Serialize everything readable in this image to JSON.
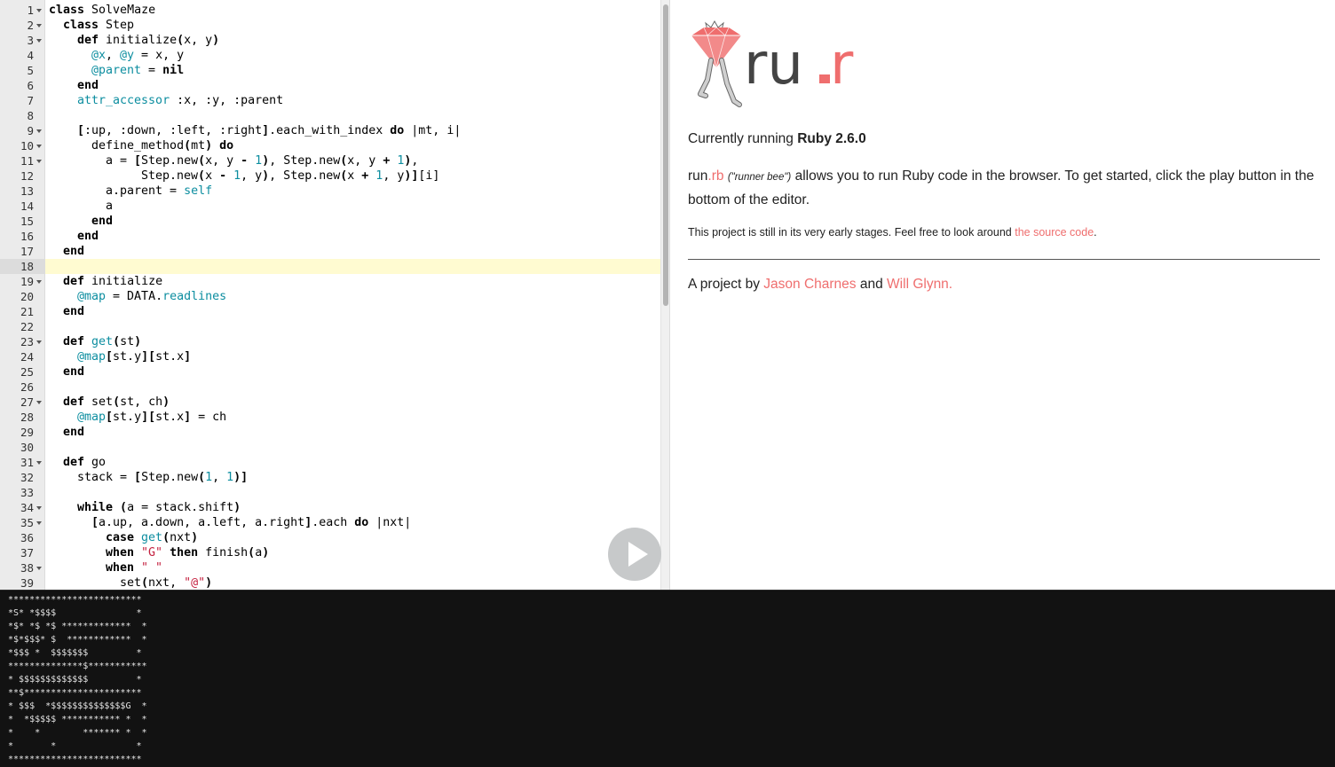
{
  "editor": {
    "active_line": 18,
    "run_button_label": "Run",
    "lines": [
      {
        "n": "1",
        "f": true,
        "i": 0,
        "t": [
          [
            "k",
            "class"
          ],
          [
            "p",
            " SolveMaze"
          ]
        ]
      },
      {
        "n": "2",
        "f": true,
        "i": 1,
        "t": [
          [
            "k",
            "class"
          ],
          [
            "p",
            " Step"
          ]
        ]
      },
      {
        "n": "3",
        "f": true,
        "i": 2,
        "t": [
          [
            "k",
            "def"
          ],
          [
            "p",
            " initialize"
          ],
          [
            "k",
            "("
          ],
          [
            "p",
            "x, y"
          ],
          [
            "k",
            ")"
          ]
        ]
      },
      {
        "n": "4",
        "f": false,
        "i": 3,
        "t": [
          [
            "i",
            "@x"
          ],
          [
            "p",
            ", "
          ],
          [
            "i",
            "@y"
          ],
          [
            "p",
            " = x, y"
          ]
        ]
      },
      {
        "n": "5",
        "f": false,
        "i": 3,
        "t": [
          [
            "i",
            "@parent"
          ],
          [
            "p",
            " = "
          ],
          [
            "k",
            "nil"
          ]
        ]
      },
      {
        "n": "6",
        "f": false,
        "i": 2,
        "t": [
          [
            "k",
            "end"
          ]
        ]
      },
      {
        "n": "7",
        "f": false,
        "i": 2,
        "t": [
          [
            "i",
            "attr_accessor"
          ],
          [
            "p",
            " :x, :y, :parent"
          ]
        ]
      },
      {
        "n": "8",
        "f": false,
        "i": 0,
        "t": []
      },
      {
        "n": "9",
        "f": true,
        "i": 2,
        "t": [
          [
            "k",
            "["
          ],
          [
            "p",
            ":up, :down, :left, :right"
          ],
          [
            "k",
            "]"
          ],
          [
            "p",
            ".each_with_index "
          ],
          [
            "k",
            "do"
          ],
          [
            "p",
            " |mt, i|"
          ]
        ]
      },
      {
        "n": "10",
        "f": true,
        "i": 3,
        "t": [
          [
            "p",
            "define_method"
          ],
          [
            "k",
            "("
          ],
          [
            "p",
            "mt"
          ],
          [
            "k",
            ")"
          ],
          [
            "p",
            " "
          ],
          [
            "k",
            "do"
          ]
        ]
      },
      {
        "n": "11",
        "f": true,
        "i": 4,
        "t": [
          [
            "p",
            "a = "
          ],
          [
            "k",
            "["
          ],
          [
            "p",
            "Step.new"
          ],
          [
            "k",
            "("
          ],
          [
            "p",
            "x, y "
          ],
          [
            "k",
            "-"
          ],
          [
            "p",
            " "
          ],
          [
            "n",
            "1"
          ],
          [
            "k",
            ")"
          ],
          [
            "p",
            ", Step.new"
          ],
          [
            "k",
            "("
          ],
          [
            "p",
            "x, y "
          ],
          [
            "k",
            "+"
          ],
          [
            "p",
            " "
          ],
          [
            "n",
            "1"
          ],
          [
            "k",
            ")"
          ],
          [
            "p",
            ","
          ]
        ]
      },
      {
        "n": "12",
        "f": false,
        "i": 6.5,
        "t": [
          [
            "p",
            "Step.new"
          ],
          [
            "k",
            "("
          ],
          [
            "p",
            "x "
          ],
          [
            "k",
            "-"
          ],
          [
            "p",
            " "
          ],
          [
            "n",
            "1"
          ],
          [
            "p",
            ", y"
          ],
          [
            "k",
            ")"
          ],
          [
            "p",
            ", Step.new"
          ],
          [
            "k",
            "("
          ],
          [
            "p",
            "x "
          ],
          [
            "k",
            "+"
          ],
          [
            "p",
            " "
          ],
          [
            "n",
            "1"
          ],
          [
            "p",
            ", y"
          ],
          [
            "k",
            ")]"
          ],
          [
            "p",
            "[i]"
          ]
        ]
      },
      {
        "n": "13",
        "f": false,
        "i": 4,
        "t": [
          [
            "p",
            "a.parent = "
          ],
          [
            "i",
            "self"
          ]
        ]
      },
      {
        "n": "14",
        "f": false,
        "i": 4,
        "t": [
          [
            "p",
            "a"
          ]
        ]
      },
      {
        "n": "15",
        "f": false,
        "i": 3,
        "t": [
          [
            "k",
            "end"
          ]
        ]
      },
      {
        "n": "16",
        "f": false,
        "i": 2,
        "t": [
          [
            "k",
            "end"
          ]
        ]
      },
      {
        "n": "17",
        "f": false,
        "i": 1,
        "t": [
          [
            "k",
            "end"
          ]
        ]
      },
      {
        "n": "18",
        "f": false,
        "i": 0,
        "t": []
      },
      {
        "n": "19",
        "f": true,
        "i": 1,
        "t": [
          [
            "k",
            "def"
          ],
          [
            "p",
            " initialize"
          ]
        ]
      },
      {
        "n": "20",
        "f": false,
        "i": 2,
        "t": [
          [
            "i",
            "@map"
          ],
          [
            "p",
            " = DATA."
          ],
          [
            "i",
            "readlines"
          ]
        ]
      },
      {
        "n": "21",
        "f": false,
        "i": 1,
        "t": [
          [
            "k",
            "end"
          ]
        ]
      },
      {
        "n": "22",
        "f": false,
        "i": 0,
        "t": []
      },
      {
        "n": "23",
        "f": true,
        "i": 1,
        "t": [
          [
            "k",
            "def"
          ],
          [
            "p",
            " "
          ],
          [
            "i",
            "get"
          ],
          [
            "k",
            "("
          ],
          [
            "p",
            "st"
          ],
          [
            "k",
            ")"
          ]
        ]
      },
      {
        "n": "24",
        "f": false,
        "i": 2,
        "t": [
          [
            "i",
            "@map"
          ],
          [
            "k",
            "["
          ],
          [
            "p",
            "st.y"
          ],
          [
            "k",
            "]["
          ],
          [
            "p",
            "st.x"
          ],
          [
            "k",
            "]"
          ]
        ]
      },
      {
        "n": "25",
        "f": false,
        "i": 1,
        "t": [
          [
            "k",
            "end"
          ]
        ]
      },
      {
        "n": "26",
        "f": false,
        "i": 0,
        "t": []
      },
      {
        "n": "27",
        "f": true,
        "i": 1,
        "t": [
          [
            "k",
            "def"
          ],
          [
            "p",
            " set"
          ],
          [
            "k",
            "("
          ],
          [
            "p",
            "st, ch"
          ],
          [
            "k",
            ")"
          ]
        ]
      },
      {
        "n": "28",
        "f": false,
        "i": 2,
        "t": [
          [
            "i",
            "@map"
          ],
          [
            "k",
            "["
          ],
          [
            "p",
            "st.y"
          ],
          [
            "k",
            "]["
          ],
          [
            "p",
            "st.x"
          ],
          [
            "k",
            "]"
          ],
          [
            "p",
            " = ch"
          ]
        ]
      },
      {
        "n": "29",
        "f": false,
        "i": 1,
        "t": [
          [
            "k",
            "end"
          ]
        ]
      },
      {
        "n": "30",
        "f": false,
        "i": 0,
        "t": []
      },
      {
        "n": "31",
        "f": true,
        "i": 1,
        "t": [
          [
            "k",
            "def"
          ],
          [
            "p",
            " go"
          ]
        ]
      },
      {
        "n": "32",
        "f": false,
        "i": 2,
        "t": [
          [
            "p",
            "stack = "
          ],
          [
            "k",
            "["
          ],
          [
            "p",
            "Step.new"
          ],
          [
            "k",
            "("
          ],
          [
            "n",
            "1"
          ],
          [
            "p",
            ", "
          ],
          [
            "n",
            "1"
          ],
          [
            "k",
            ")]"
          ]
        ]
      },
      {
        "n": "33",
        "f": false,
        "i": 0,
        "t": []
      },
      {
        "n": "34",
        "f": true,
        "i": 2,
        "t": [
          [
            "k",
            "while"
          ],
          [
            "p",
            " "
          ],
          [
            "k",
            "("
          ],
          [
            "p",
            "a = stack.shift"
          ],
          [
            "k",
            ")"
          ]
        ]
      },
      {
        "n": "35",
        "f": true,
        "i": 3,
        "t": [
          [
            "k",
            "["
          ],
          [
            "p",
            "a.up, a.down, a.left, a.right"
          ],
          [
            "k",
            "]"
          ],
          [
            "p",
            ".each "
          ],
          [
            "k",
            "do"
          ],
          [
            "p",
            " |nxt|"
          ]
        ]
      },
      {
        "n": "36",
        "f": false,
        "i": 4,
        "t": [
          [
            "k",
            "case"
          ],
          [
            "p",
            " "
          ],
          [
            "i",
            "get"
          ],
          [
            "k",
            "("
          ],
          [
            "p",
            "nxt"
          ],
          [
            "k",
            ")"
          ]
        ]
      },
      {
        "n": "37",
        "f": false,
        "i": 4,
        "t": [
          [
            "k",
            "when"
          ],
          [
            "p",
            " "
          ],
          [
            "s",
            "\"G\""
          ],
          [
            "p",
            " "
          ],
          [
            "k",
            "then"
          ],
          [
            "p",
            " finish"
          ],
          [
            "k",
            "("
          ],
          [
            "p",
            "a"
          ],
          [
            "k",
            ")"
          ]
        ]
      },
      {
        "n": "38",
        "f": true,
        "i": 4,
        "t": [
          [
            "k",
            "when"
          ],
          [
            "p",
            " "
          ],
          [
            "s",
            "\" \""
          ]
        ]
      },
      {
        "n": "39",
        "f": false,
        "i": 5,
        "t": [
          [
            "p",
            "set"
          ],
          [
            "k",
            "("
          ],
          [
            "p",
            "nxt, "
          ],
          [
            "s",
            "\"@\""
          ],
          [
            "k",
            ")"
          ]
        ]
      }
    ]
  },
  "info": {
    "logo": {
      "wordmark_left": "ru",
      "wordmark_dot": ".",
      "wordmark_right": "r",
      "colors": {
        "gem": "#ef6e6e",
        "text": "#444444",
        "accent": "#ef6e6e"
      }
    },
    "running_prefix": "Currently running ",
    "running_version": "Ruby 2.6.0",
    "about": {
      "brand_name": "run",
      "brand_ext": ".rb",
      "nickname": "(\"runner bee\")",
      "text": " allows you to run Ruby code in the browser. To get started, click the play button in the bottom of the editor."
    },
    "early": {
      "text": "This project is still in its very early stages. Feel free to look around ",
      "link": "the source code",
      "end": "."
    },
    "credits": {
      "prefix": "A project by ",
      "author1": "Jason Charnes",
      "joiner": " and ",
      "author2": "Will Glynn."
    }
  },
  "console": {
    "output": "*************************\n*S* *$$$$               *\n*$* *$ *$ *************  *\n*$*$$$* $  ************  *\n*$$$ *  $$$$$$$         *\n**************$***********\n* $$$$$$$$$$$$$         *\n**$**********************\n* $$$  *$$$$$$$$$$$$$$G  *\n*  *$$$$$ *********** *  *\n*    *        ******* *  *\n*       *               *\n*************************"
  }
}
